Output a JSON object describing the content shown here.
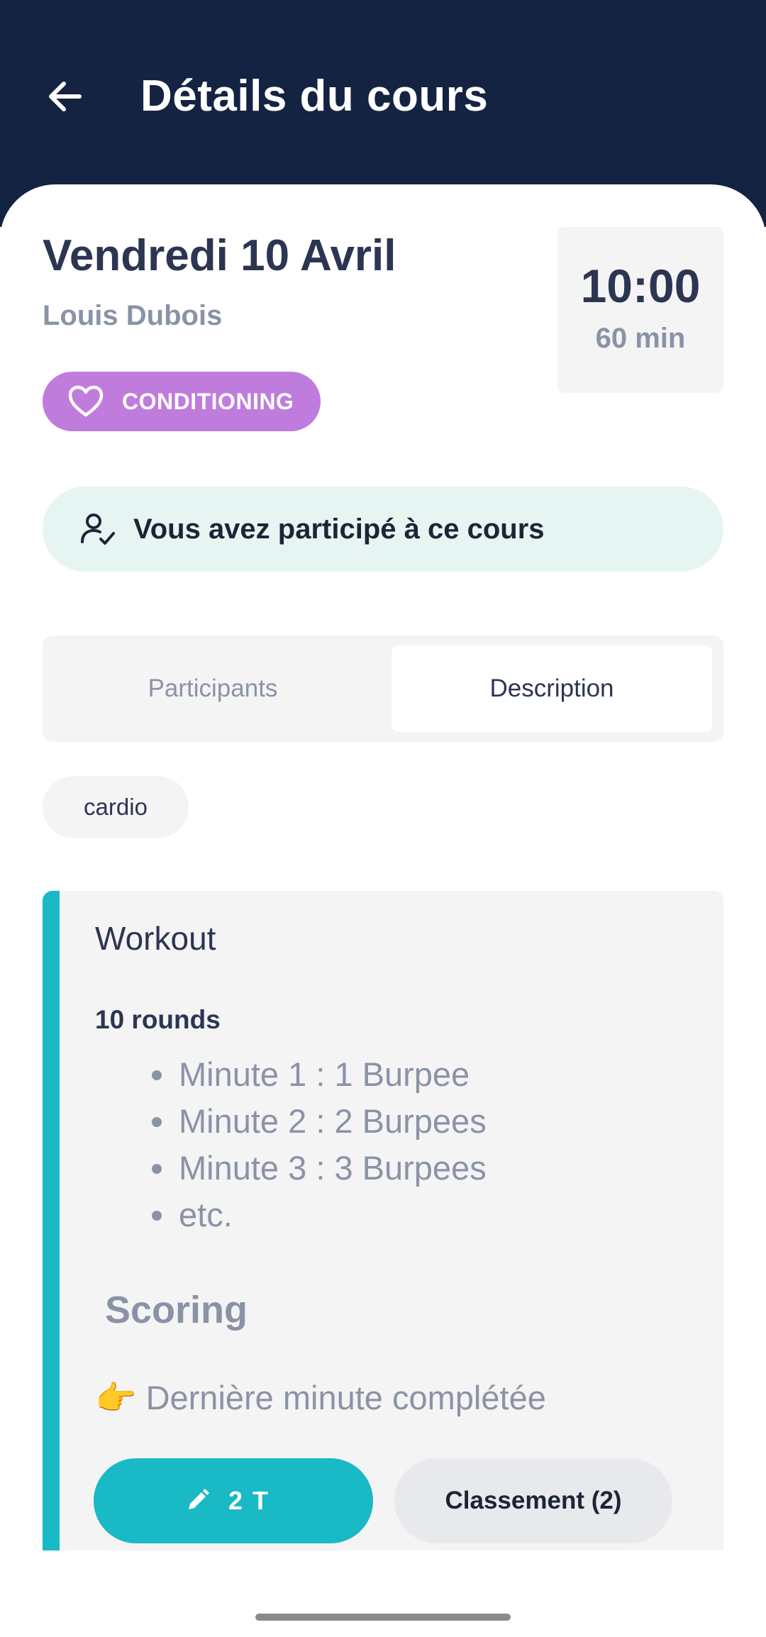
{
  "header": {
    "title": "Détails du cours",
    "back_icon": "arrow-left-icon"
  },
  "course": {
    "date": "Vendredi 10 Avril",
    "coach": "Louis Dubois",
    "time": "10:00",
    "duration": "60 min",
    "category": {
      "label": "CONDITIONING",
      "icon": "heart-icon",
      "color": "#c07cdd"
    }
  },
  "attendance": {
    "text": "Vous avez participé à ce cours",
    "icon": "user-check-icon"
  },
  "tabs": [
    {
      "label": "Participants",
      "active": false
    },
    {
      "label": "Description",
      "active": true
    }
  ],
  "tags": [
    "cardio"
  ],
  "workout": {
    "title": "Workout",
    "rounds": "10 rounds",
    "items": [
      "Minute 1 : 1 Burpee",
      "Minute 2 : 2 Burpees",
      "Minute 3 : 3 Burpees",
      "etc."
    ],
    "scoring_title": "Scoring",
    "scoring_line": "👉 Dernière minute complétée",
    "accent_color": "#19b9c6"
  },
  "actions": {
    "score_label": "2 T",
    "score_icon": "pencil-icon",
    "ranking_label": "Classement (2)"
  },
  "colors": {
    "header_bg": "#142341",
    "attendance_bg": "#e6f5f2"
  }
}
